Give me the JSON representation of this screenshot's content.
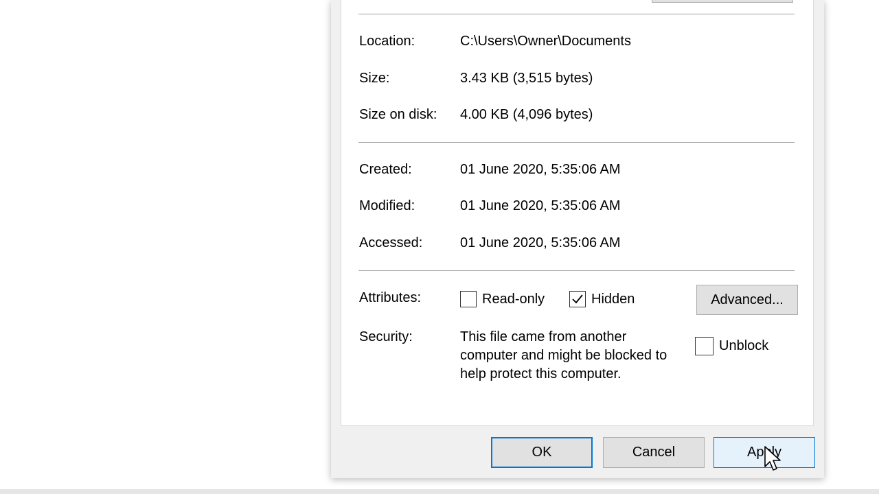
{
  "general": {
    "location_label": "Location:",
    "location_value": "C:\\Users\\Owner\\Documents",
    "size_label": "Size:",
    "size_value": "3.43 KB (3,515 bytes)",
    "size_on_disk_label": "Size on disk:",
    "size_on_disk_value": "4.00 KB (4,096 bytes)",
    "created_label": "Created:",
    "created_value": "01 June 2020, 5:35:06 AM",
    "modified_label": "Modified:",
    "modified_value": "01 June 2020, 5:35:06 AM",
    "accessed_label": "Accessed:",
    "accessed_value": "01 June 2020, 5:35:06 AM"
  },
  "attributes": {
    "label": "Attributes:",
    "read_only_label": "Read-only",
    "read_only_checked": false,
    "hidden_label": "Hidden",
    "hidden_checked": true,
    "advanced_label": "Advanced..."
  },
  "security": {
    "label": "Security:",
    "message": "This file came from another computer and might be blocked to help protect this computer.",
    "unblock_label": "Unblock",
    "unblock_checked": false
  },
  "footer": {
    "ok_label": "OK",
    "cancel_label": "Cancel",
    "apply_label": "Apply"
  },
  "colors": {
    "accent": "#0078d7",
    "dialog_bg": "#f0f0f0",
    "button_bg": "#e1e1e1"
  },
  "icons": {
    "checkmark": "check-icon",
    "cursor": "mouse-pointer-icon"
  }
}
